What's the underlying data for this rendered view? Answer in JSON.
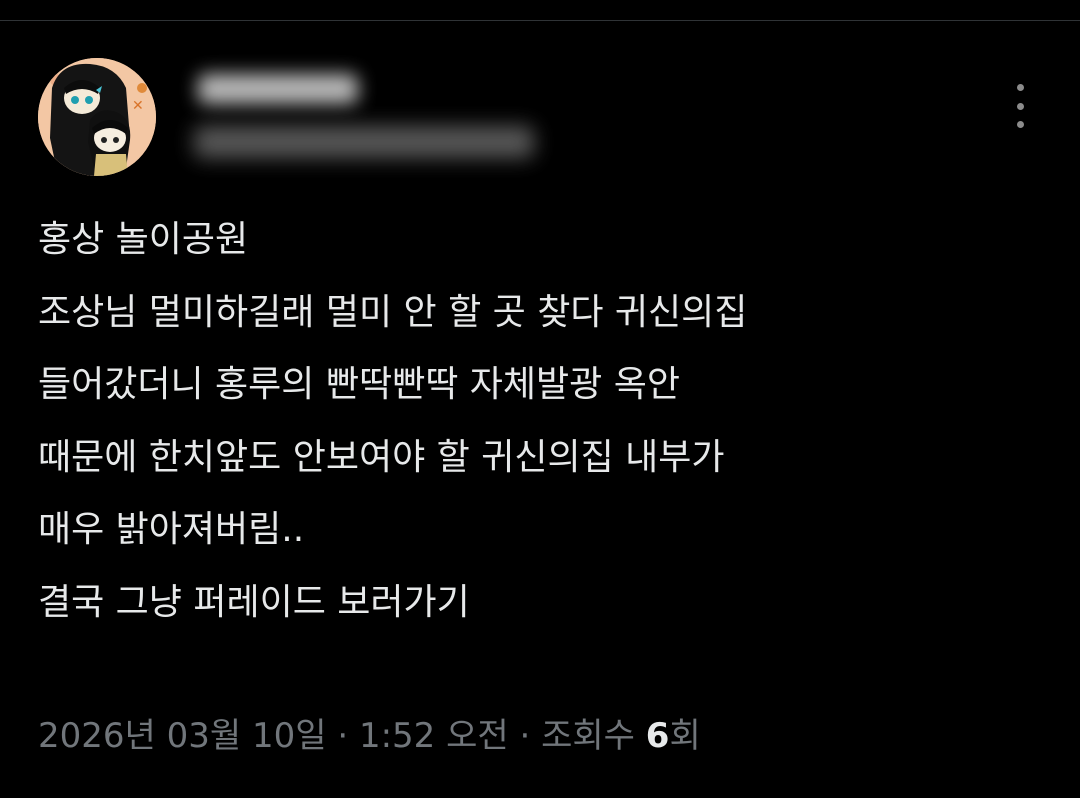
{
  "tweet": {
    "author": {
      "avatar_icon": "profile-avatar-illustration",
      "name_blurred": true,
      "handle_blurred": true
    },
    "more_icon": "more-vertical-icon",
    "lines": [
      "홍상 놀이공원",
      "조상님 멀미하길래 멀미 안 할 곳 찾다 귀신의집",
      "들어갔더니 홍루의 빤딱빤딱 자체발광 옥안",
      "때문에 한치앞도 안보여야 할 귀신의집 내부가",
      "매우 밝아져버림..",
      "결국 그냥 퍼레이드 보러가기"
    ],
    "meta": {
      "date": "2026년 03월 10일",
      "separator1": " · ",
      "time": "1:52 오전",
      "separator2": " · ",
      "views_label": "조회수 ",
      "views_count": "6",
      "views_suffix": "회"
    }
  },
  "colors": {
    "background": "#000000",
    "text": "#e7e9ea",
    "secondary_text": "#71767b",
    "divider": "#2f3336"
  }
}
